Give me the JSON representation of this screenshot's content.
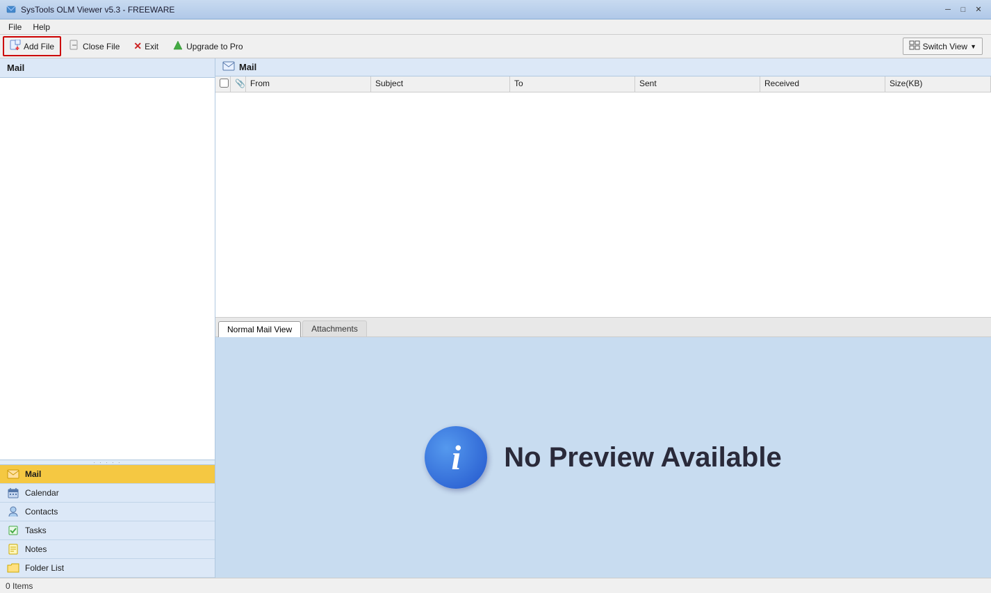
{
  "titleBar": {
    "title": "SysTools OLM Viewer v5.3 - FREEWARE",
    "icon": "app-icon",
    "controls": {
      "minimize": "─",
      "maximize": "□",
      "close": "✕"
    }
  },
  "menuBar": {
    "items": [
      {
        "id": "file-menu",
        "label": "File"
      },
      {
        "id": "help-menu",
        "label": "Help"
      }
    ]
  },
  "toolbar": {
    "addFile": "Add File",
    "closeFile": "Close File",
    "exit": "Exit",
    "upgradeToPro": "Upgrade to Pro",
    "switchView": "Switch View"
  },
  "sidebar": {
    "header": "Mail",
    "navItems": [
      {
        "id": "mail",
        "label": "Mail",
        "active": true
      },
      {
        "id": "calendar",
        "label": "Calendar"
      },
      {
        "id": "contacts",
        "label": "Contacts"
      },
      {
        "id": "tasks",
        "label": "Tasks"
      },
      {
        "id": "notes",
        "label": "Notes"
      },
      {
        "id": "folder-list",
        "label": "Folder List"
      }
    ]
  },
  "emailList": {
    "header": "Mail",
    "columns": [
      {
        "id": "check",
        "label": ""
      },
      {
        "id": "attach",
        "label": ""
      },
      {
        "id": "from",
        "label": "From"
      },
      {
        "id": "subject",
        "label": "Subject"
      },
      {
        "id": "to",
        "label": "To"
      },
      {
        "id": "sent",
        "label": "Sent"
      },
      {
        "id": "received",
        "label": "Received"
      },
      {
        "id": "size",
        "label": "Size(KB)"
      }
    ],
    "rows": []
  },
  "previewTabs": [
    {
      "id": "normal-mail-view",
      "label": "Normal Mail View",
      "active": true
    },
    {
      "id": "attachments",
      "label": "Attachments",
      "active": false
    }
  ],
  "previewPanel": {
    "noPreviewText": "No Preview Available",
    "infoIcon": "i"
  },
  "statusBar": {
    "itemCount": "0 Items"
  }
}
